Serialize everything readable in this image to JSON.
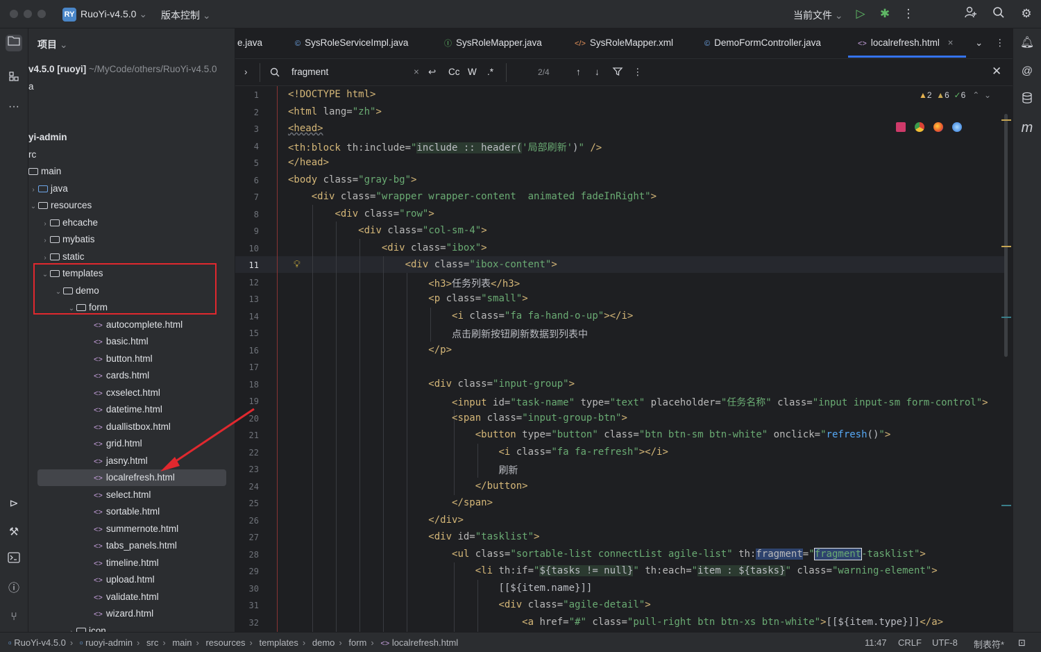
{
  "titlebar": {
    "project_badge": "RY",
    "project_name": "RuoYi-v4.5.0",
    "vcs": "版本控制",
    "run_config": "当前文件"
  },
  "project_panel": {
    "title": "项目",
    "tree": [
      {
        "label": "v4.5.0 [ruoyi]",
        "extra": "~/MyCode/others/RuoYi-v4.5.0"
      },
      {
        "label": "a"
      },
      {
        "label": "yi-admin"
      },
      {
        "label": "rc"
      },
      {
        "label": "main"
      },
      {
        "label": "java"
      },
      {
        "label": "resources"
      },
      {
        "label": "ehcache"
      },
      {
        "label": "mybatis"
      },
      {
        "label": "static"
      },
      {
        "label": "templates"
      },
      {
        "label": "demo"
      },
      {
        "label": "form"
      },
      {
        "label": "autocomplete.html"
      },
      {
        "label": "basic.html"
      },
      {
        "label": "button.html"
      },
      {
        "label": "cards.html"
      },
      {
        "label": "cxselect.html"
      },
      {
        "label": "datetime.html"
      },
      {
        "label": "duallistbox.html"
      },
      {
        "label": "grid.html"
      },
      {
        "label": "jasny.html"
      },
      {
        "label": "localrefresh.html"
      },
      {
        "label": "select.html"
      },
      {
        "label": "sortable.html"
      },
      {
        "label": "summernote.html"
      },
      {
        "label": "tabs_panels.html"
      },
      {
        "label": "timeline.html"
      },
      {
        "label": "upload.html"
      },
      {
        "label": "validate.html"
      },
      {
        "label": "wizard.html"
      },
      {
        "label": "icon"
      }
    ]
  },
  "tabs": [
    {
      "label": "e.java",
      "icon": ""
    },
    {
      "label": "SysRoleServiceImpl.java",
      "icon": "©"
    },
    {
      "label": "SysRoleMapper.java",
      "icon": "Ⓘ"
    },
    {
      "label": "SysRoleMapper.xml",
      "icon": "</>"
    },
    {
      "label": "DemoFormController.java",
      "icon": "©"
    },
    {
      "label": "localrefresh.html",
      "icon": "<>"
    }
  ],
  "find": {
    "query": "fragment",
    "match_case": "Cc",
    "words": "W",
    "regex": ".*",
    "count": "2/4"
  },
  "inspections": {
    "warn1": "2",
    "warn2": "6",
    "ok": "6"
  },
  "editor": {
    "line_numbers": [
      "1",
      "2",
      "3",
      "4",
      "5",
      "6",
      "7",
      "8",
      "9",
      "10",
      "11",
      "12",
      "13",
      "14",
      "15",
      "16",
      "17",
      "18",
      "19",
      "20",
      "21",
      "22",
      "23",
      "24",
      "25",
      "26",
      "27",
      "28",
      "29",
      "30",
      "31",
      "32"
    ],
    "current_line": "11"
  },
  "status": {
    "crumbs": [
      "RuoYi-v4.5.0",
      "ruoyi-admin",
      "src",
      "main",
      "resources",
      "templates",
      "demo",
      "form",
      "localrefresh.html"
    ],
    "position": "11:47",
    "line_sep": "CRLF",
    "encoding": "UTF-8",
    "indent": "制表符*"
  },
  "colors": {
    "accent": "#3574f0",
    "highlight_box": "#e0282e",
    "arrow": "#e0282e"
  },
  "icons": [
    "folder-icon",
    "structure-icon",
    "more-icon",
    "services-icon",
    "build-icon",
    "terminal-icon",
    "problems-icon",
    "git-icon",
    "add-user-icon",
    "search-icon",
    "settings-icon",
    "run-icon",
    "debug-icon",
    "bell-icon",
    "ai-icon",
    "database-icon",
    "m-icon"
  ]
}
